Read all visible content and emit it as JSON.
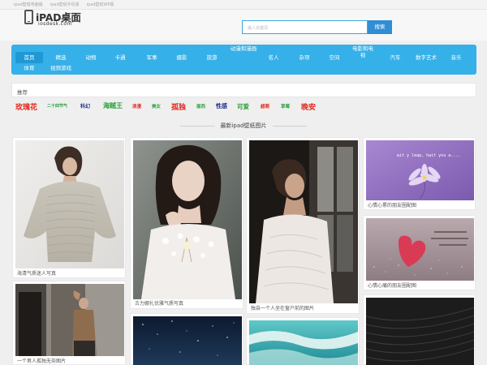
{
  "topbar": {
    "links": [
      "ipad壁纸电脑版",
      "ipad壁纸手机版",
      "ipad壁纸WP版"
    ]
  },
  "logo": {
    "name": "iPAD桌面",
    "domain": "iosdesk.com"
  },
  "search": {
    "placeholder": "输入关键词",
    "button": "搜索"
  },
  "nav": {
    "row1": [
      "首页",
      "精选",
      "动物",
      "卡通",
      "军事",
      "摄影",
      "旅游",
      "动漫和漫画",
      "名人",
      "杂项",
      "空间",
      "电影和电视",
      "汽车",
      "数字艺术",
      "音乐"
    ],
    "row2": [
      "体育",
      "视频游戏"
    ]
  },
  "recommend": {
    "label": "推荐"
  },
  "tags": [
    "玫瑰花",
    "二十四节气",
    "科幻",
    "海贼王",
    "浪漫",
    "美女",
    "孤独",
    "南西",
    "性感",
    "可爱",
    "超萌",
    "草莓",
    "晚安"
  ],
  "section": {
    "title": "最新ipad壁纸图片"
  },
  "cards": [
    {
      "caption": "海清气质迷人写真"
    },
    {
      "caption": "一个男人孤独无奈图片"
    },
    {
      "caption": "古力娜扎优雅气质写真"
    },
    {
      "caption": "独自一个人坐在窗户前的图片"
    },
    {
      "caption": "心情心累的朋友圈配图",
      "overlay": "wit y leap, hait you a...."
    },
    {
      "caption": "心情心痛的朋友圈配图"
    }
  ],
  "colors": {
    "nav_bg": "#36b0e8",
    "nav_active": "#1e99d6",
    "search_button": "#2f8ed4",
    "tags": [
      "#e0271b",
      "#2aa03a",
      "#1f2d8f",
      "#2aa03a",
      "#e0271b",
      "#2aa03a",
      "#e0271b",
      "#2aa03a",
      "#1f2d8f",
      "#2aa03a",
      "#e0271b",
      "#2aa03a",
      "#e0271b"
    ]
  }
}
